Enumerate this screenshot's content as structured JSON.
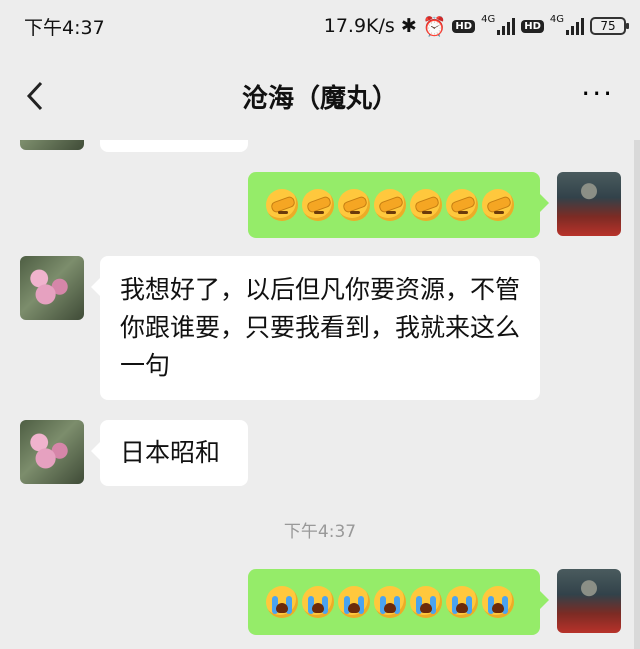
{
  "status_bar": {
    "time": "下午4:37",
    "speed": "17.9K/s",
    "net1": "4G",
    "net2": "4G",
    "hd": "HD",
    "battery": "75",
    "icons": [
      "bluetooth-icon",
      "alarm-icon",
      "hd-icon",
      "signal-icon",
      "battery-icon"
    ]
  },
  "nav": {
    "title": "沧海（魔丸）",
    "back_icon": "chevron-left-icon",
    "more_label": "···"
  },
  "messages": [
    {
      "type": "emoji",
      "side": "right",
      "emojis": [
        "facepalm",
        "facepalm",
        "facepalm",
        "facepalm",
        "facepalm",
        "facepalm",
        "facepalm"
      ]
    },
    {
      "type": "text",
      "side": "left",
      "text": "我想好了，以后但凡你要资源，不管你跟谁要，只要我看到，我就来这么一句"
    },
    {
      "type": "text",
      "side": "left",
      "text": "日本昭和"
    },
    {
      "type": "time",
      "text": "下午4:37"
    },
    {
      "type": "emoji",
      "side": "right",
      "emojis": [
        "crying",
        "crying",
        "crying",
        "crying",
        "crying",
        "crying",
        "crying"
      ]
    }
  ],
  "colors": {
    "background": "#ededed",
    "self_bubble": "#95ec69",
    "other_bubble": "#ffffff",
    "timestamp": "#999999"
  }
}
